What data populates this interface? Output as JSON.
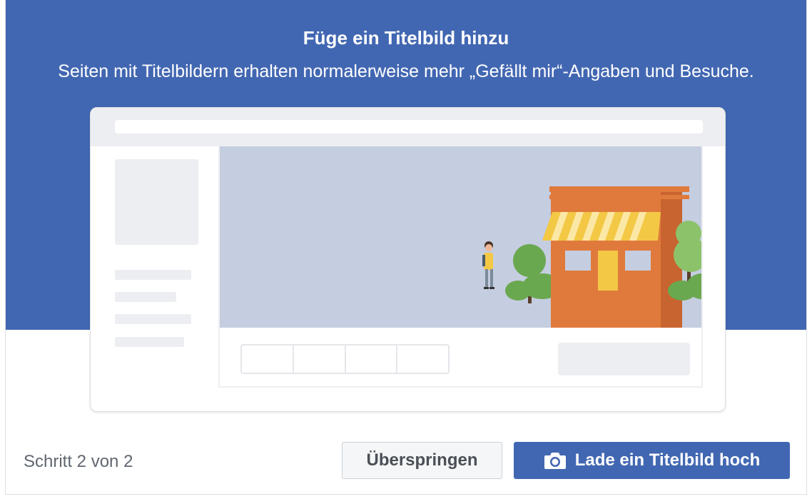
{
  "dialog": {
    "title": "Füge ein Titelbild hinzu",
    "subtitle": "Seiten mit Titelbildern erhalten normalerweise mehr „Gefällt mir“-Angaben und Besuche."
  },
  "illustration": {
    "icons": [
      "camera-icon",
      "storefront-illustration",
      "person-illustration"
    ]
  },
  "footer": {
    "step_text": "Schritt 2 von 2",
    "skip_label": "Überspringen",
    "upload_label": "Lade ein Titelbild hoch"
  },
  "colors": {
    "brand_blue": "#4267b2",
    "placeholder_gray": "#edeef1",
    "cover_bg": "#c5cde0",
    "shop_orange": "#e07a3c",
    "awning_yellow": "#f3c845",
    "tree_green": "#6aa84f"
  }
}
